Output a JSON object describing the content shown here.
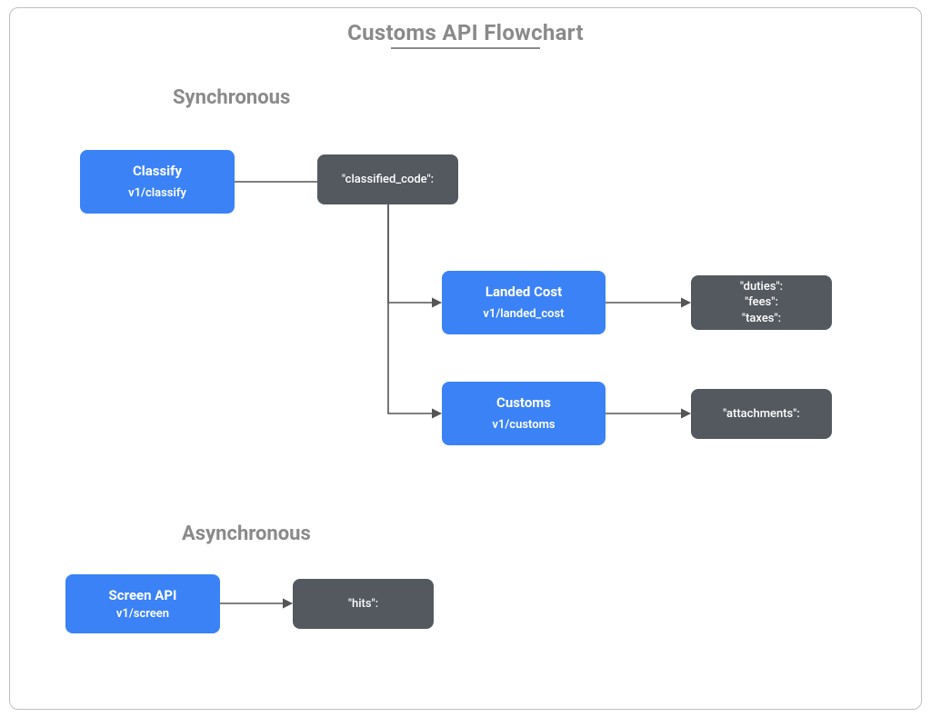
{
  "title": "Customs API Flowchart",
  "sections": {
    "sync": "Synchronous",
    "async": "Asynchronous"
  },
  "nodes": {
    "classify": {
      "title": "Classify",
      "sub": "v1/classify"
    },
    "classified_code": {
      "line1": "\"classified_code\":"
    },
    "landed_cost": {
      "title": "Landed Cost",
      "sub": "v1/landed_cost"
    },
    "landed_cost_out": {
      "line1": "\"duties\":",
      "line2": "\"fees\":",
      "line3": "\"taxes\":"
    },
    "customs": {
      "title": "Customs",
      "sub": "v1/customs"
    },
    "customs_out": {
      "line1": "\"attachments\":"
    },
    "screen": {
      "title": "Screen API",
      "sub": "v1/screen"
    },
    "screen_out": {
      "line1": "\"hits\":"
    }
  }
}
